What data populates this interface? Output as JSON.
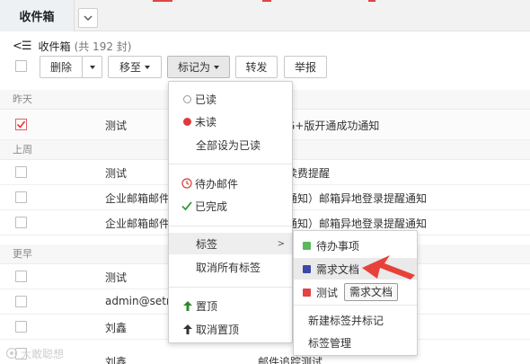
{
  "tabbar": {
    "active_tab": "收件箱"
  },
  "header": {
    "back_glyph": "<☰",
    "folder_name": "收件箱",
    "count_text": "(共 192 封)"
  },
  "toolbar": {
    "delete_label": "删除",
    "move_label": "移至",
    "mark_label": "标记为",
    "forward_label": "转发",
    "report_label": "举报"
  },
  "mail_list": {
    "groups": [
      {
        "label": "昨天",
        "rows": [
          {
            "sender": "测试",
            "subject": "G+版开通成功通知",
            "selected": true
          }
        ]
      },
      {
        "label": "上周",
        "rows": [
          {
            "sender": "测试",
            "subject": "续费提醒",
            "selected": false
          },
          {
            "sender": "企业邮箱邮件",
            "subject": "通知）邮箱异地登录提醒通知",
            "selected": false
          },
          {
            "sender": "企业邮箱邮件",
            "subject": "通知）邮箱异地登录提醒通知",
            "selected": false
          }
        ]
      },
      {
        "label": "更早",
        "rows": [
          {
            "sender": "测试",
            "subject": "",
            "selected": false
          },
          {
            "sender": "admin@setm",
            "subject": "",
            "selected": false
          },
          {
            "sender": "刘鑫",
            "subject": "",
            "selected": false
          },
          {
            "sender": "刘鑫",
            "subject": "邮件追踪测试",
            "selected": false
          }
        ]
      }
    ]
  },
  "mark_menu": {
    "read": "已读",
    "unread": "未读",
    "mark_all_read": "全部设为已读",
    "todo_mail": "待办邮件",
    "done": "已完成",
    "tags": "标签",
    "tags_arrow": ">",
    "remove_all_tags": "取消所有标签",
    "pin": "置顶",
    "unpin": "取消置顶"
  },
  "tag_submenu": {
    "items": [
      {
        "label": "待办事项",
        "color": "#5cb85c"
      },
      {
        "label": "需求文档",
        "color": "#3b4aa8"
      },
      {
        "label": "测试",
        "color": "#e04444",
        "extra_tag": "需求文档"
      }
    ],
    "new_tag": "新建标签并标记",
    "manage_tags": "标签管理"
  },
  "annotation": {
    "arrow_color": "#e8413a"
  },
  "colors": {
    "accent_red": "#e03a3a",
    "done_green": "#3a9a3a",
    "pin_green": "#2f8a2f"
  },
  "watermark": {
    "text": "大敢聪想"
  }
}
